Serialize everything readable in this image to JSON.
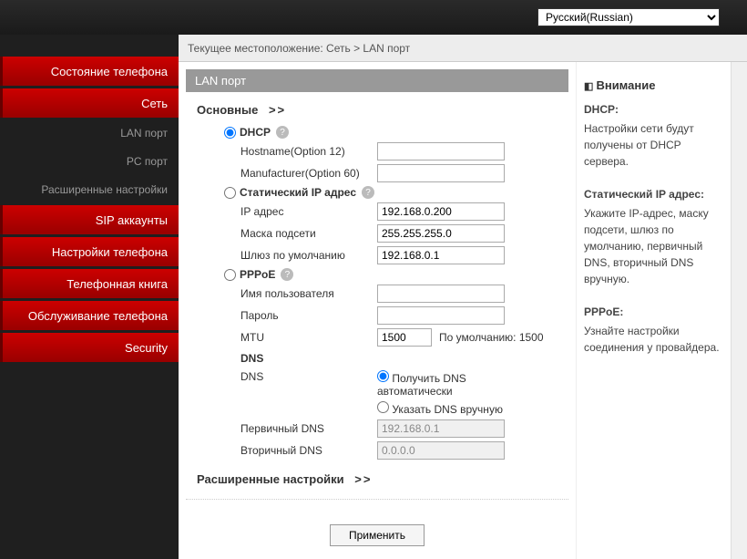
{
  "lang": {
    "selected": "Русский(Russian)"
  },
  "breadcrumb": "Текущее местоположение: Сеть > LAN порт",
  "sidebar": {
    "items": [
      {
        "label": "Состояние телефона"
      },
      {
        "label": "Сеть"
      },
      {
        "label": "LAN порт"
      },
      {
        "label": "PC порт"
      },
      {
        "label": "Расширенные настройки"
      },
      {
        "label": "SIP аккаунты"
      },
      {
        "label": "Настройки телефона"
      },
      {
        "label": "Телефонная книга"
      },
      {
        "label": "Обслуживание телефона"
      },
      {
        "label": "Security"
      }
    ]
  },
  "panel": {
    "title": "LAN порт"
  },
  "sections": {
    "basic": {
      "label": "Основные",
      "arrows": ">>"
    },
    "advanced": {
      "label": "Расширенные настройки",
      "arrows": ">>"
    }
  },
  "form": {
    "mode": "dhcp",
    "dhcp": {
      "label": "DHCP",
      "hostname_label": "Hostname(Option 12)",
      "hostname": "",
      "manufacturer_label": "Manufacturer(Option 60)",
      "manufacturer": ""
    },
    "static": {
      "label": "Статический IP адрес",
      "ip_label": "IP адрес",
      "ip": "192.168.0.200",
      "mask_label": "Маска подсети",
      "mask": "255.255.255.0",
      "gw_label": "Шлюз по умолчанию",
      "gw": "192.168.0.1"
    },
    "pppoe": {
      "label": "PPPoE",
      "user_label": "Имя пользователя",
      "user": "",
      "pass_label": "Пароль",
      "pass": "",
      "mtu_label": "MTU",
      "mtu": "1500",
      "mtu_default": "По умолчанию: 1500"
    },
    "dns": {
      "heading": "DNS",
      "label": "DNS",
      "mode": "auto",
      "auto_label": "Получить DNS автоматически",
      "manual_label": "Указать DNS вручную",
      "primary_label": "Первичный DNS",
      "primary": "192.168.0.1",
      "secondary_label": "Вторичный DNS",
      "secondary": "0.0.0.0"
    }
  },
  "submit_label": "Применить",
  "help": {
    "title": "Внимание",
    "dhcp_title": "DHCP:",
    "dhcp_text": "Настройки сети будут получены от DHCP сервера.",
    "static_title": "Статический IP адрес:",
    "static_text": "Укажите IP-адрес, маску подсети, шлюз по умолчанию, первичный DNS, вторичный DNS вручную.",
    "pppoe_title": "PPPoE:",
    "pppoe_text": "Узнайте настройки соединения у провайдера."
  }
}
